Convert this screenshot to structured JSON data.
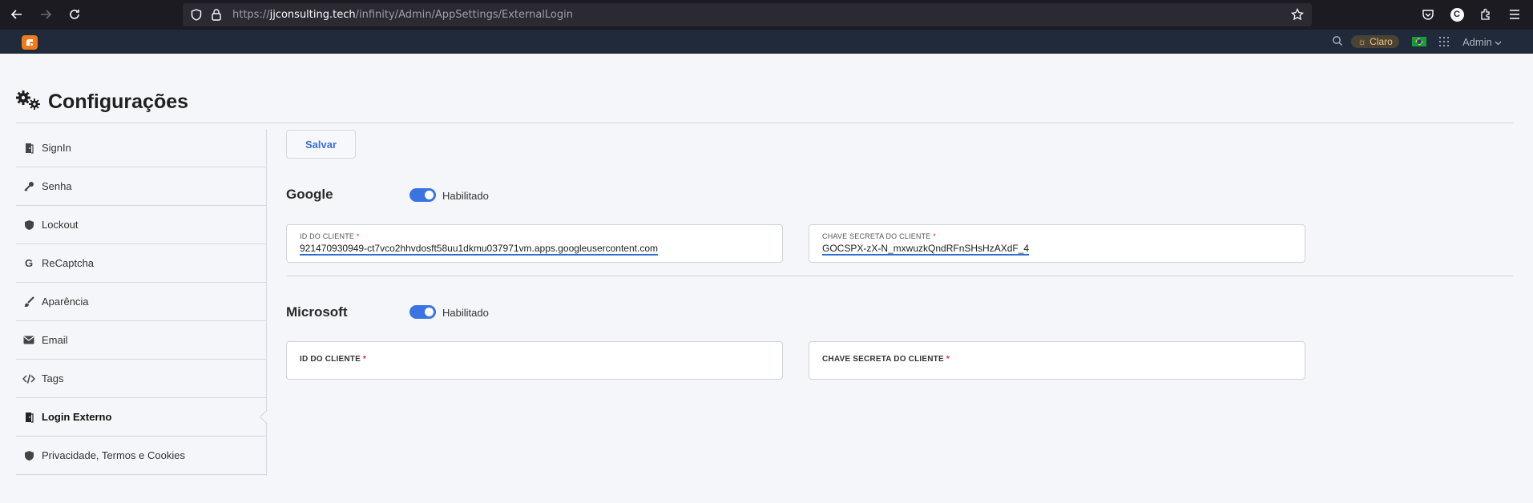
{
  "browser": {
    "url_prefix": "https://",
    "url_host": "jjconsulting.tech",
    "url_path": "/infinity/Admin/AppSettings/ExternalLogin",
    "profile_initial": "C"
  },
  "header": {
    "theme_label": "Claro",
    "user_label": "Admin"
  },
  "page": {
    "title": "Configurações"
  },
  "sidebar": {
    "items": [
      {
        "label": "SignIn",
        "icon": "door-icon"
      },
      {
        "label": "Senha",
        "icon": "key-icon"
      },
      {
        "label": "Lockout",
        "icon": "shield-icon"
      },
      {
        "label": "ReCaptcha",
        "icon": "google-icon"
      },
      {
        "label": "Aparência",
        "icon": "brush-icon"
      },
      {
        "label": "Email",
        "icon": "envelope-icon"
      },
      {
        "label": "Tags",
        "icon": "code-icon"
      },
      {
        "label": "Login Externo",
        "icon": "door-icon"
      },
      {
        "label": "Privacidade, Termos e Cookies",
        "icon": "shield-icon"
      }
    ]
  },
  "toolbar": {
    "save_label": "Salvar"
  },
  "google": {
    "title": "Google",
    "toggle_label": "Habilitado",
    "client_id_label": "ID DO CLIENTE",
    "client_id_value": "921470930949-ct7vco2hhvdosft58uu1dkmu037971vm.apps.googleusercontent.com",
    "client_secret_label": "CHAVE SECRETA DO CLIENTE",
    "client_secret_value": "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"
  },
  "microsoft": {
    "title": "Microsoft",
    "toggle_label": "Habilitado",
    "client_id_label": "ID DO CLIENTE",
    "client_secret_label": "CHAVE SECRETA DO CLIENTE"
  },
  "required_marker": "*"
}
